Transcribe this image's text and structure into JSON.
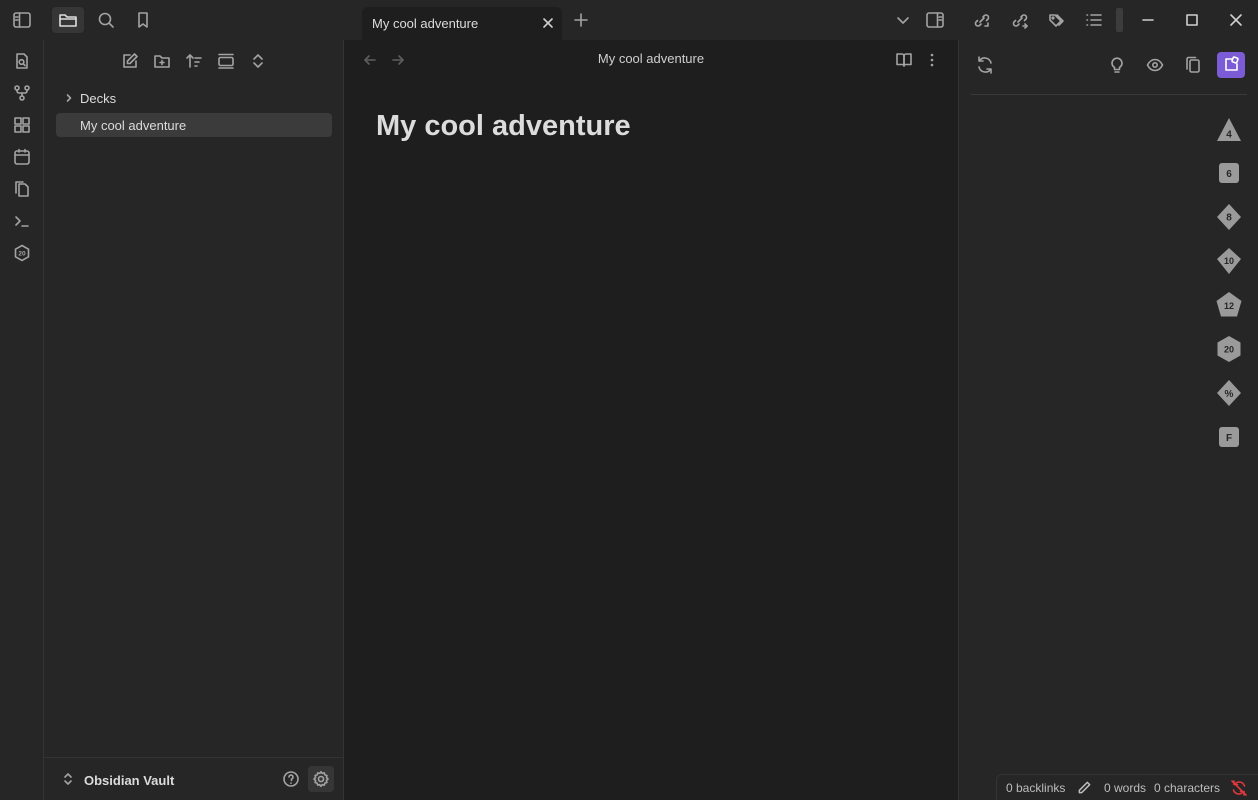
{
  "tab": {
    "title": "My cool adventure"
  },
  "editor": {
    "view_title": "My cool adventure",
    "heading": "My cool adventure"
  },
  "explorer": {
    "items": [
      {
        "label": "Decks",
        "type": "folder",
        "collapsed": true
      },
      {
        "label": "My cool adventure",
        "type": "file",
        "selected": true
      }
    ]
  },
  "vault": {
    "name": "Obsidian Vault"
  },
  "dice": [
    "4",
    "6",
    "8",
    "10",
    "12",
    "20",
    "%",
    "F"
  ],
  "status": {
    "backlinks": "0 backlinks",
    "words": "0 words",
    "characters": "0 characters"
  },
  "colors": {
    "accent": "#7c5cd6",
    "background": "#1e1e1e",
    "panel": "#262626",
    "warning": "#e0383e"
  }
}
